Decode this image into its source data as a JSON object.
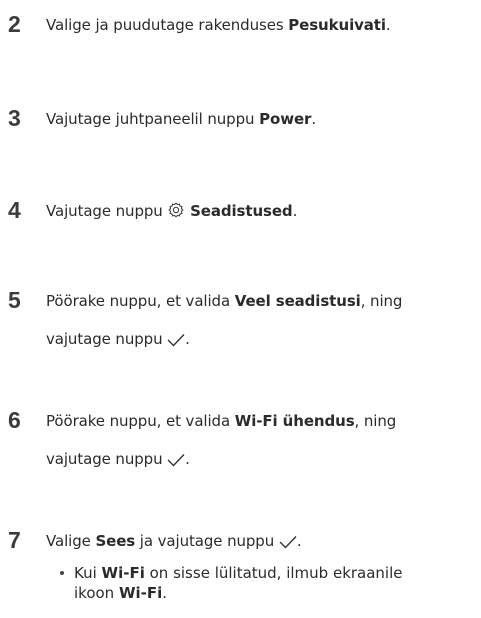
{
  "steps": [
    {
      "number": "2",
      "pre": "Valige ja puudutage rakenduses ",
      "bold": "Pesukuivati",
      "post": "."
    },
    {
      "number": "3",
      "pre": "Vajutage juhtpaneelil nuppu ",
      "bold": "Power",
      "post": "."
    },
    {
      "number": "4",
      "pre": "Vajutage nuppu ",
      "icon": "gear-icon",
      "bold": "Seadistused",
      "post": "."
    },
    {
      "number": "5",
      "pre": "Pöörake nuppu, et valida ",
      "bold": "Veel seadistusi",
      "post": ", ning",
      "line2": "vajutage nuppu",
      "line2_icon": "checkmark-icon",
      "line2_post": "."
    },
    {
      "number": "6",
      "pre": "Pöörake nuppu, et valida ",
      "bold": "Wi-Fi ühendus",
      "post": ", ning",
      "line2": "vajutage nuppu",
      "line2_icon": "checkmark-icon",
      "line2_post": "."
    },
    {
      "number": "7",
      "pre": "Valige ",
      "bold": "Sees",
      "post": " ja vajutage nuppu",
      "icon_after": "checkmark-icon",
      "post2": "."
    }
  ],
  "note": {
    "pre": "Kui ",
    "bold": "Wi-Fi",
    "post": " on sisse lülitatud, ilmub ekraanile",
    "line2_pre": "ikoon ",
    "line2_bold": "Wi-Fi",
    "line2_post": "."
  }
}
